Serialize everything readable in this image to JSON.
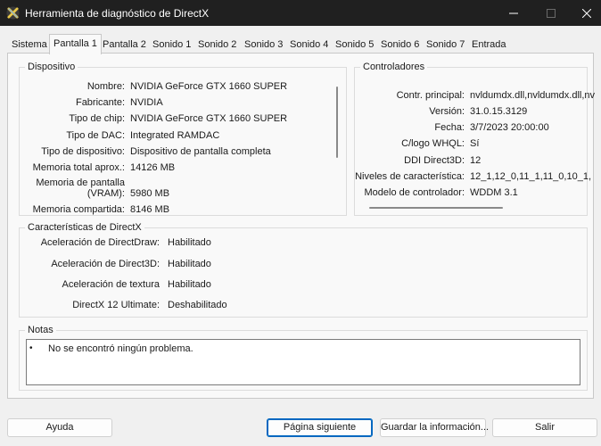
{
  "window": {
    "title": "Herramienta de diagnóstico de DirectX",
    "icon": "directx-x-icon"
  },
  "tabs": [
    {
      "label": "Sistema"
    },
    {
      "label": "Pantalla 1",
      "active": true
    },
    {
      "label": "Pantalla 2"
    },
    {
      "label": "Sonido 1"
    },
    {
      "label": "Sonido 2"
    },
    {
      "label": "Sonido 3"
    },
    {
      "label": "Sonido 4"
    },
    {
      "label": "Sonido 5"
    },
    {
      "label": "Sonido 6"
    },
    {
      "label": "Sonido 7"
    },
    {
      "label": "Entrada"
    }
  ],
  "device": {
    "title": "Dispositivo",
    "rows": [
      {
        "label": "Nombre:",
        "value": "NVIDIA GeForce GTX 1660 SUPER"
      },
      {
        "label": "Fabricante:",
        "value": "NVIDIA"
      },
      {
        "label": "Tipo de chip:",
        "value": "NVIDIA GeForce GTX 1660 SUPER"
      },
      {
        "label": "Tipo de DAC:",
        "value": "Integrated RAMDAC"
      },
      {
        "label": "Tipo de dispositivo:",
        "value": "Dispositivo de pantalla completa"
      },
      {
        "label": "Memoria total aprox.:",
        "value": "14126 MB"
      },
      {
        "label_line1": "Memoria de pantalla",
        "label_line2": "(VRAM):",
        "value": "5980 MB"
      },
      {
        "label": "Memoria compartida:",
        "value": "8146 MB"
      }
    ]
  },
  "drivers": {
    "title": "Controladores",
    "rows": [
      {
        "label": "Contr. principal:",
        "value": "nvldumdx.dll,nvldumdx.dll,nv"
      },
      {
        "label": "Versión:",
        "value": "31.0.15.3129"
      },
      {
        "label": "Fecha:",
        "value": "3/7/2023 20:00:00"
      },
      {
        "label": "C/logo WHQL:",
        "value": "Sí"
      },
      {
        "label": "DDI Direct3D:",
        "value": "12"
      },
      {
        "label": "Niveles de característica:",
        "value": "12_1,12_0,11_1,11_0,10_1,"
      },
      {
        "label": "Modelo de controlador:",
        "value": "WDDM 3.1"
      }
    ]
  },
  "features": {
    "title": "Características de DirectX",
    "rows": [
      {
        "label": "Aceleración de DirectDraw:",
        "value": "Habilitado"
      },
      {
        "label": "Aceleración de Direct3D:",
        "value": "Habilitado"
      },
      {
        "label": "Aceleración de textura",
        "value": "Habilitado"
      },
      {
        "label": "DirectX 12 Ultimate:",
        "value": "Deshabilitado"
      }
    ]
  },
  "notes": {
    "title": "Notas",
    "items": [
      "No se encontró ningún problema."
    ]
  },
  "buttons": {
    "help": "Ayuda",
    "next_page": "Página siguiente",
    "save_info": "Guardar la información...",
    "exit": "Salir"
  }
}
